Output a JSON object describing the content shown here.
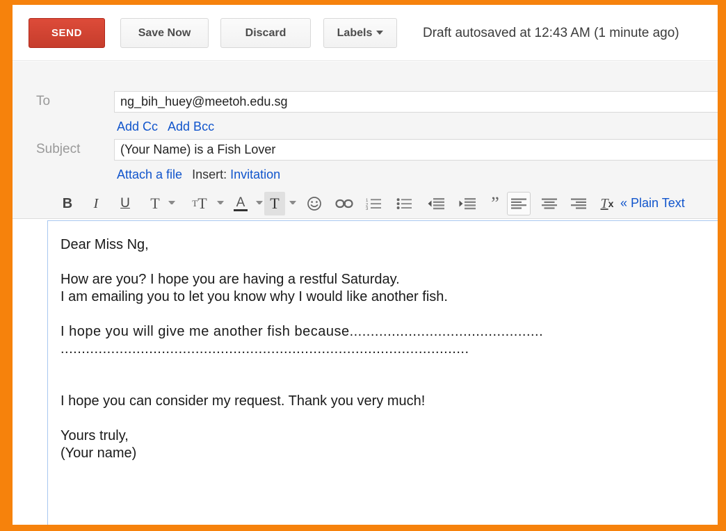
{
  "window": {
    "frame_color": "#F6820C",
    "page_background": "#ffffff"
  },
  "action_bar": {
    "send_label": "SEND",
    "send_color": "#D14836",
    "save_now_label": "Save Now",
    "discard_label": "Discard",
    "labels_label": "Labels",
    "autosave_status": "Draft autosaved at 12:43 AM (1 minute ago)"
  },
  "compose_header": {
    "to_label": "To",
    "to_value": "ng_bih_huey@meetoh.edu.sg",
    "add_cc_label": "Add Cc",
    "add_bcc_label": "Add Bcc",
    "subject_label": "Subject",
    "subject_value": "(Your Name) is a Fish Lover",
    "attach_label": "Attach a file",
    "insert_label": "Insert:",
    "invitation_label": "Invitation"
  },
  "format_toolbar": {
    "link_color": "#1155cc",
    "plain_text_label": "« Plain Text",
    "items": [
      {
        "name": "bold-icon",
        "label": "B",
        "caret": false,
        "state": "normal"
      },
      {
        "name": "italic-icon",
        "label": "I",
        "caret": false,
        "state": "normal"
      },
      {
        "name": "underline-icon",
        "label": "U",
        "caret": false,
        "state": "normal"
      },
      {
        "name": "font-family-icon",
        "label": "T",
        "caret": true,
        "state": "normal"
      },
      {
        "name": "font-size-icon",
        "label": "TT",
        "caret": true,
        "state": "normal"
      },
      {
        "name": "text-color-icon",
        "label": "A",
        "caret": true,
        "state": "normal"
      },
      {
        "name": "highlight-color-icon",
        "label": "T",
        "caret": true,
        "state": "selected"
      },
      {
        "name": "emoji-icon",
        "label": "smiley",
        "caret": false,
        "state": "normal"
      },
      {
        "name": "insert-link-icon",
        "label": "link",
        "caret": false,
        "state": "normal"
      },
      {
        "name": "numbered-list-icon",
        "label": "ordered list",
        "caret": false,
        "state": "normal"
      },
      {
        "name": "bulleted-list-icon",
        "label": "unordered list",
        "caret": false,
        "state": "normal"
      },
      {
        "name": "outdent-icon",
        "label": "decrease indent",
        "caret": false,
        "state": "normal"
      },
      {
        "name": "indent-icon",
        "label": "increase indent",
        "caret": false,
        "state": "normal"
      },
      {
        "name": "quote-icon",
        "label": "quote",
        "caret": false,
        "state": "normal"
      },
      {
        "name": "align-left-icon",
        "label": "align left",
        "caret": false,
        "state": "boxed"
      },
      {
        "name": "align-center-icon",
        "label": "align center",
        "caret": false,
        "state": "normal"
      },
      {
        "name": "align-right-icon",
        "label": "align right",
        "caret": false,
        "state": "normal"
      },
      {
        "name": "remove-formatting-icon",
        "label": "Tx",
        "caret": false,
        "state": "normal"
      }
    ]
  },
  "compose_body": {
    "greeting": "Dear Miss Ng,",
    "paragraph_1_line_1": "How are you? I hope you are having a restful Saturday.",
    "paragraph_1_line_2": "I am emailing you to let you know why I would like another fish.",
    "paragraph_2": "I hope you will give me another fish because..............................................",
    "paragraph_2_continued": ".................................................................................................",
    "paragraph_3": "I hope you can consider my request. Thank you very much!",
    "signoff_line_1": "Yours truly,",
    "signoff_line_2": "(Your name)"
  }
}
